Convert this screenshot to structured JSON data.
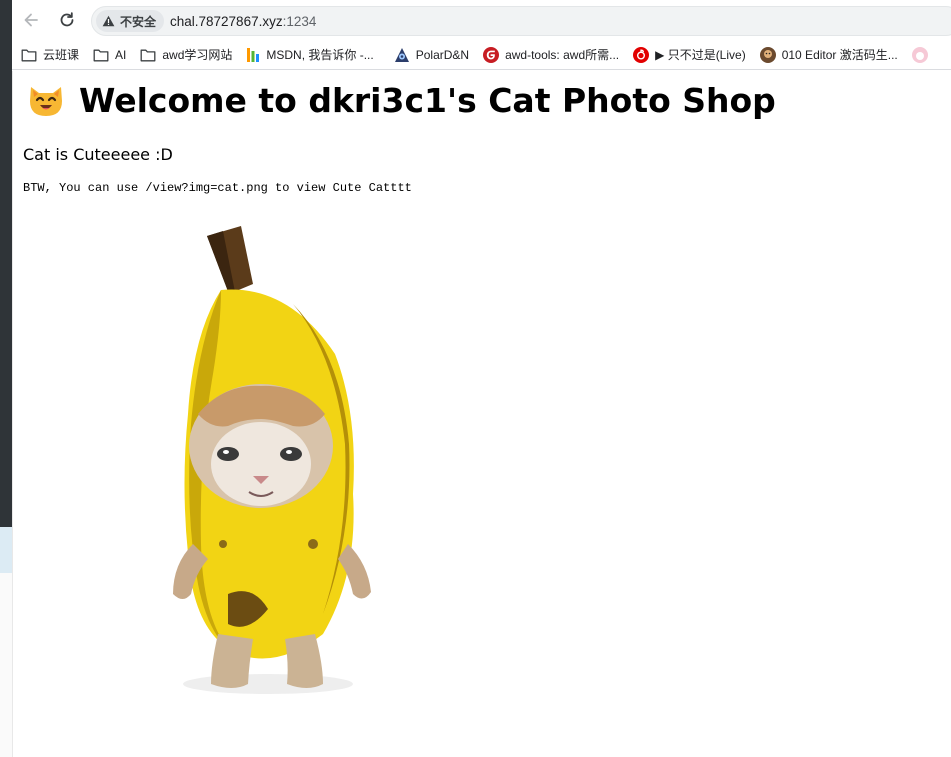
{
  "browser": {
    "security_label": "不安全",
    "url_host": "chal.78727867.xyz",
    "url_port": ":1234"
  },
  "bookmarks": [
    {
      "label": "云班课",
      "icon": "folder-icon"
    },
    {
      "label": "AI",
      "icon": "folder-icon"
    },
    {
      "label": "awd学习网站",
      "icon": "folder-icon"
    },
    {
      "label": "MSDN, 我告诉你 -...",
      "icon": "msdn-icon"
    },
    {
      "label": "PolarD&N",
      "icon": "polar-icon"
    },
    {
      "label": "awd-tools: awd所需...",
      "icon": "gitee-icon"
    },
    {
      "label": "▶ 只不过是(Live)",
      "icon": "netease-music-icon"
    },
    {
      "label": "010 Editor 激活码生...",
      "icon": "avatar-icon"
    }
  ],
  "page": {
    "heading": "Welcome to dkri3c1's Cat Photo Shop",
    "subtitle": "Cat is Cuteeeee :D",
    "hint": "BTW, You can use /view?img=cat.png to view Cute Catttt"
  },
  "colors": {
    "banana": "#f2d414",
    "toolbar_bg": "#ffffff",
    "omnibox_bg": "#f1f3f4"
  }
}
